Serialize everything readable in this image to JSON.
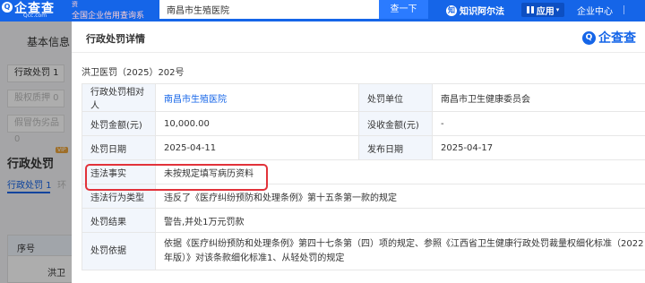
{
  "topbar": {
    "logo_badge": "Q",
    "logo_text": "企查查",
    "logo_url": "Qcc.com",
    "slogan_top": "资",
    "slogan": "全国企业信用查询系",
    "search_value": "南昌市生殖医院",
    "search_button": "查一下",
    "nav_zhifa_badge": "知",
    "nav_zhifa": "知识阿尔法",
    "nav_app": "应用",
    "nav_center": "企业中心"
  },
  "background": {
    "title": "基本信息",
    "tabs": [
      "行政处罚 1",
      "股权质押 0",
      "假冒伪劣品 0"
    ],
    "section_title": "行政处罚",
    "vip": "VIP",
    "subtab_active": "行政处罚 1",
    "subtab_other": "环",
    "table_head": "序号",
    "table_cell": "洪卫"
  },
  "modal": {
    "title": "行政处罚详情",
    "brand_badge": "Q",
    "brand": "企查查",
    "case_no": "洪卫医罚（2025）202号",
    "rows": [
      {
        "l1": "行政处罚相对人",
        "v1": "南昌市生殖医院",
        "l2": "处罚单位",
        "v2": "南昌市卫生健康委员会"
      },
      {
        "l1": "处罚金额(元)",
        "v1": "10,000.00",
        "l2": "没收金额(元)",
        "v2": "-"
      },
      {
        "l1": "处罚日期",
        "v1": "2025-04-11",
        "l2": "发布日期",
        "v2": "2025-04-17"
      }
    ],
    "illegal_fact_label": "违法事实",
    "illegal_fact": "未按规定填写病历资料",
    "violation_type_label": "违法行为类型",
    "violation_type": "违反了《医疗纠纷预防和处理条例》第十五条第一款的规定",
    "result_label": "处罚结果",
    "result": "警告,并处1万元罚款",
    "basis_label": "处罚依据",
    "basis": "依据《医疗纠纷预防和处理条例》第四十七条第（四）项的规定、参照《江西省卫生健康行政处罚裁量权细化标准（2022年版）》对该条款细化标准1、从轻处罚的规定"
  },
  "colors": {
    "brand": "#1565e8",
    "highlight": "#e2323a",
    "label_bg": "#f2f6fc"
  }
}
